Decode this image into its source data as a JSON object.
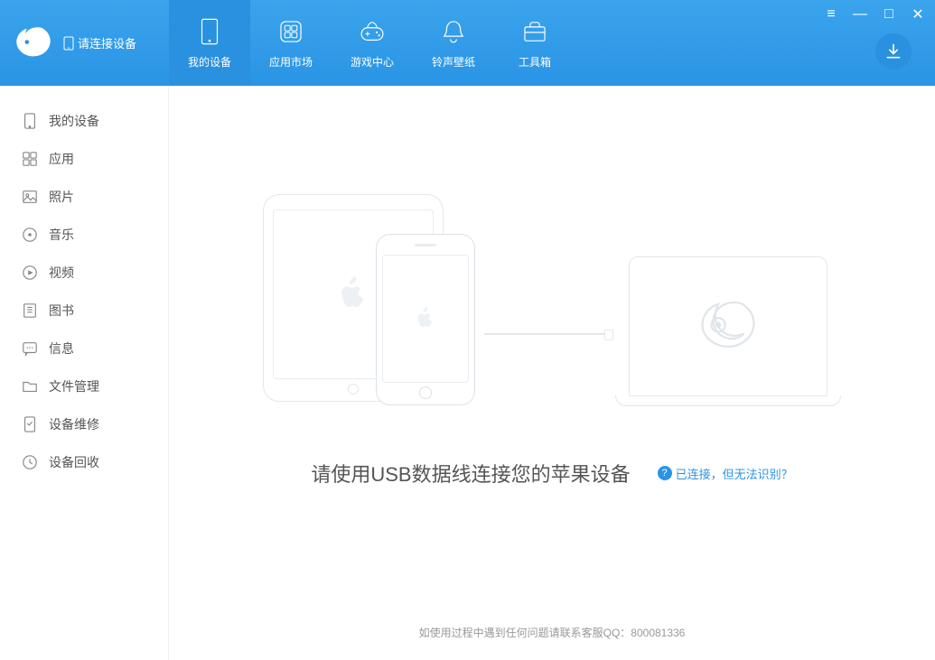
{
  "header": {
    "connect_hint": "请连接设备"
  },
  "nav": [
    {
      "label": "我的设备",
      "icon": "device-icon"
    },
    {
      "label": "应用市场",
      "icon": "apps-icon"
    },
    {
      "label": "游戏中心",
      "icon": "game-icon"
    },
    {
      "label": "铃声壁纸",
      "icon": "bell-icon"
    },
    {
      "label": "工具箱",
      "icon": "toolbox-icon"
    }
  ],
  "sidebar": {
    "items": [
      {
        "label": "我的设备",
        "icon": "device"
      },
      {
        "label": "应用",
        "icon": "apps"
      },
      {
        "label": "照片",
        "icon": "photo"
      },
      {
        "label": "音乐",
        "icon": "music"
      },
      {
        "label": "视频",
        "icon": "video"
      },
      {
        "label": "图书",
        "icon": "book"
      },
      {
        "label": "信息",
        "icon": "chat"
      },
      {
        "label": "文件管理",
        "icon": "folder"
      },
      {
        "label": "设备维修",
        "icon": "repair"
      },
      {
        "label": "设备回收",
        "icon": "recycle"
      }
    ]
  },
  "main": {
    "prompt": "请使用USB数据线连接您的苹果设备",
    "help_link": "已连接，但无法识别？",
    "footer_hint": "如使用过程中遇到任何问题请联系客服QQ：800081336"
  }
}
